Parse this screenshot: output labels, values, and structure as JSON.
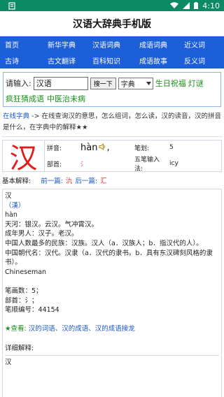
{
  "status_bar": {
    "time": "4:10",
    "bg": "#0b8a63"
  },
  "app_title": "汉语大辞典手机版",
  "nav": {
    "items": [
      "首页",
      "新华字典",
      "汉语词典",
      "成语词典",
      "近义词",
      "古诗",
      "古文翻译",
      "百科知识",
      "成语故事",
      "反义词"
    ],
    "bg": "#1c5fd9"
  },
  "search": {
    "label": "请输入:",
    "value": "汉语",
    "button": "搜一下",
    "select": "字典",
    "links": [
      "生日祝福",
      "灯谜",
      "疯狂猜成语",
      "中医治未病"
    ]
  },
  "breadcrumb": {
    "link": "在线字典",
    "text": " -> 在线查询汉的意思，怎么组词，怎么读，汉的读音，汉的拼音是什么，在字典中的解释★★"
  },
  "entry": {
    "char": "汉",
    "pinyin_label": "拼音:",
    "pinyin": "hàn",
    "pinyin_suffix": ",",
    "radical_label": "部首:",
    "radical": "氵",
    "strokes_label": "笔划:",
    "strokes": "5",
    "wubi_label": "五笔输入法:",
    "wubi": "icy"
  },
  "basic": {
    "label": "基本解释:",
    "prev_label": "前一篇:",
    "prev_char": "氿",
    "next_label": "后一篇:",
    "next_char": "汇"
  },
  "definition": {
    "lines": [
      "汉",
      "（漢）",
      "hàn",
      "天河：银汉。云汉。气冲霄汉。",
      "成年男人：汉子。老汉。",
      "中国人数最多的民族：汉族。汉人（a．汉族人；b．指汉代的人）。",
      "中国朝代名：汉代。汉隶（a．汉代的隶书。b．具有东汉碑刻风格的隶书）。",
      "Chineseman",
      "",
      "笔画数：5；",
      "部首：氵；",
      "笔顺编号：44154"
    ],
    "see_label": "★查看:",
    "see_links": "汉的词语、汉的成语、汉的成语接龙",
    "detail_label": "详细解释:",
    "detail_first": "汉"
  }
}
